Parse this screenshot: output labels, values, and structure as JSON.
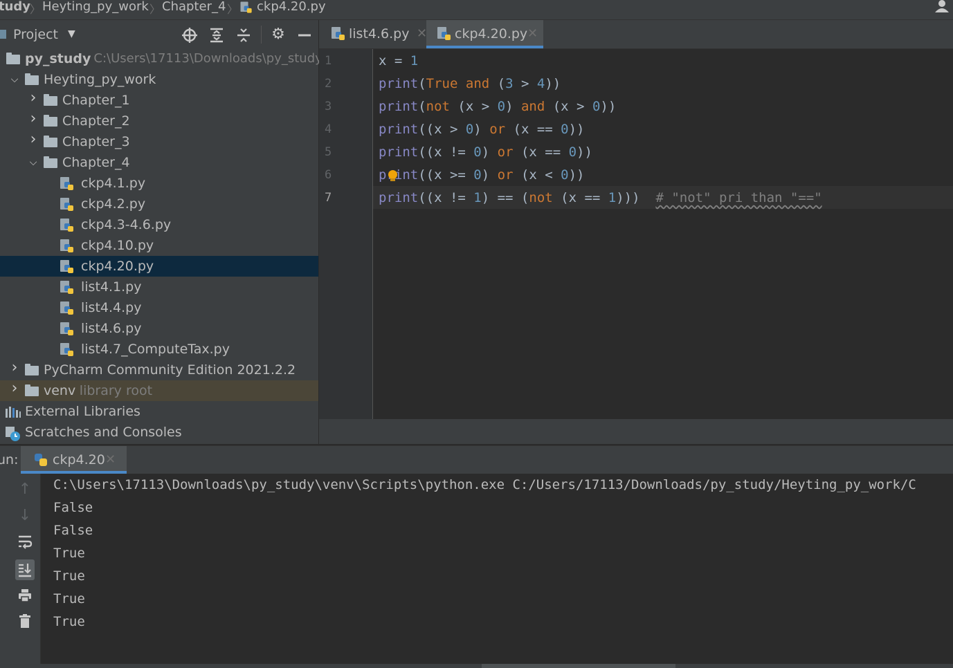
{
  "breadcrumb": {
    "items": [
      "tudy",
      "Heyting_py_work",
      "Chapter_4",
      "ckp4.20.py"
    ],
    "separator": "〉"
  },
  "project_panel": {
    "title": "Project",
    "toolbar_icons": [
      "locate-icon",
      "expand-all-icon",
      "collapse-all-icon",
      "gear-icon",
      "minimize-icon"
    ],
    "tree": [
      {
        "label": "py_study",
        "hint": "C:\\Users\\17113\\Downloads\\py_study",
        "kind": "folder",
        "level": 0,
        "expanded": true,
        "bold": true
      },
      {
        "label": "Heyting_py_work",
        "kind": "folder",
        "level": 1,
        "expanded": true
      },
      {
        "label": "Chapter_1",
        "kind": "folder",
        "level": 2,
        "expanded": false
      },
      {
        "label": "Chapter_2",
        "kind": "folder",
        "level": 2,
        "expanded": false
      },
      {
        "label": "Chapter_3",
        "kind": "folder",
        "level": 2,
        "expanded": false
      },
      {
        "label": "Chapter_4",
        "kind": "folder",
        "level": 2,
        "expanded": true
      },
      {
        "label": "ckp4.1.py",
        "kind": "py",
        "level": 3
      },
      {
        "label": "ckp4.2.py",
        "kind": "py",
        "level": 3
      },
      {
        "label": "ckp4.3-4.6.py",
        "kind": "py",
        "level": 3
      },
      {
        "label": "ckp4.10.py",
        "kind": "py",
        "level": 3
      },
      {
        "label": "ckp4.20.py",
        "kind": "py",
        "level": 3,
        "selected": true
      },
      {
        "label": "list4.1.py",
        "kind": "py",
        "level": 3
      },
      {
        "label": "list4.4.py",
        "kind": "py",
        "level": 3
      },
      {
        "label": "list4.6.py",
        "kind": "py",
        "level": 3
      },
      {
        "label": "list4.7_ComputeTax.py",
        "kind": "py",
        "level": 3
      },
      {
        "label": "PyCharm Community Edition 2021.2.2",
        "kind": "folder",
        "level": 1,
        "expanded": false
      },
      {
        "label": "venv",
        "hint": "library root",
        "kind": "folder",
        "level": 1,
        "expanded": false,
        "library": true
      },
      {
        "label": "External Libraries",
        "kind": "libs",
        "level": 0
      },
      {
        "label": "Scratches and Consoles",
        "kind": "scratch",
        "level": 0
      }
    ]
  },
  "editor_tabs": [
    {
      "label": "list4.6.py",
      "active": false
    },
    {
      "label": "ckp4.20.py",
      "active": true
    }
  ],
  "editor": {
    "current_line": 7,
    "lines": [
      [
        {
          "t": "x = ",
          "c": "plain"
        },
        {
          "t": "1",
          "c": "num"
        }
      ],
      [
        {
          "t": "print",
          "c": "fn"
        },
        {
          "t": "(",
          "c": "plain"
        },
        {
          "t": "True",
          "c": "kw"
        },
        {
          "t": " ",
          "c": "plain"
        },
        {
          "t": "and",
          "c": "kw"
        },
        {
          "t": " (",
          "c": "plain"
        },
        {
          "t": "3",
          "c": "num"
        },
        {
          "t": " > ",
          "c": "plain"
        },
        {
          "t": "4",
          "c": "num"
        },
        {
          "t": "))",
          "c": "plain"
        }
      ],
      [
        {
          "t": "print",
          "c": "fn"
        },
        {
          "t": "(",
          "c": "plain"
        },
        {
          "t": "not",
          "c": "kw"
        },
        {
          "t": " (x > ",
          "c": "plain"
        },
        {
          "t": "0",
          "c": "num"
        },
        {
          "t": ") ",
          "c": "plain"
        },
        {
          "t": "and",
          "c": "kw"
        },
        {
          "t": " (x > ",
          "c": "plain"
        },
        {
          "t": "0",
          "c": "num"
        },
        {
          "t": "))",
          "c": "plain"
        }
      ],
      [
        {
          "t": "print",
          "c": "fn"
        },
        {
          "t": "((x > ",
          "c": "plain"
        },
        {
          "t": "0",
          "c": "num"
        },
        {
          "t": ") ",
          "c": "plain"
        },
        {
          "t": "or",
          "c": "kw"
        },
        {
          "t": " (x == ",
          "c": "plain"
        },
        {
          "t": "0",
          "c": "num"
        },
        {
          "t": "))",
          "c": "plain"
        }
      ],
      [
        {
          "t": "print",
          "c": "fn"
        },
        {
          "t": "((x != ",
          "c": "plain"
        },
        {
          "t": "0",
          "c": "num"
        },
        {
          "t": ") ",
          "c": "plain"
        },
        {
          "t": "or",
          "c": "kw"
        },
        {
          "t": " (x == ",
          "c": "plain"
        },
        {
          "t": "0",
          "c": "num"
        },
        {
          "t": "))",
          "c": "plain"
        }
      ],
      [
        {
          "t": "print",
          "c": "fn"
        },
        {
          "t": "((x >= ",
          "c": "plain"
        },
        {
          "t": "0",
          "c": "num"
        },
        {
          "t": ") ",
          "c": "plain"
        },
        {
          "t": "or",
          "c": "kw"
        },
        {
          "t": " (x < ",
          "c": "plain"
        },
        {
          "t": "0",
          "c": "num"
        },
        {
          "t": "))",
          "c": "plain"
        }
      ],
      [
        {
          "t": "print",
          "c": "fn"
        },
        {
          "t": "((x != ",
          "c": "plain"
        },
        {
          "t": "1",
          "c": "num"
        },
        {
          "t": ") == (",
          "c": "plain"
        },
        {
          "t": "not",
          "c": "kw"
        },
        {
          "t": " (x == ",
          "c": "plain"
        },
        {
          "t": "1",
          "c": "num"
        },
        {
          "t": ")))  ",
          "c": "plain"
        },
        {
          "t": "# \"not\" pri than \"==\"",
          "c": "cm"
        }
      ]
    ]
  },
  "run_panel": {
    "label": "un:",
    "tab_label": "ckp4.20",
    "side_icons": [
      "up-arrow-icon",
      "down-arrow-icon",
      "soft-wrap-icon",
      "scroll-to-end-icon",
      "print-icon",
      "trash-icon"
    ],
    "output": [
      "C:\\Users\\17113\\Downloads\\py_study\\venv\\Scripts\\python.exe C:/Users/17113/Downloads/py_study/Heyting_py_work/C",
      "False",
      "False",
      "True",
      "True",
      "True",
      "True"
    ]
  },
  "colors": {
    "keyword": "#cc7832",
    "builtin": "#8888c6",
    "number": "#6897bb",
    "comment": "#808080",
    "selection": "#0d293e",
    "accent": "#4a88c7"
  }
}
